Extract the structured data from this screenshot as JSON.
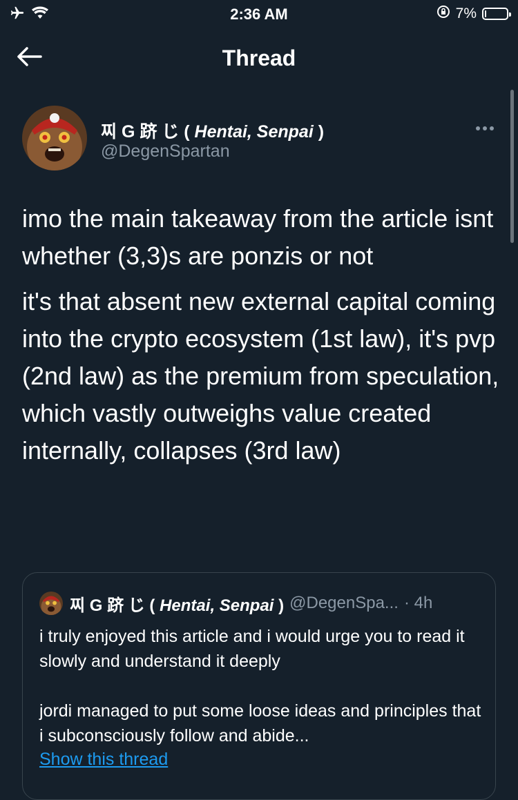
{
  "status_bar": {
    "time": "2:36 AM",
    "battery": "7%",
    "battery_level": 0.07,
    "icons": [
      "airplane-icon",
      "wifi-icon",
      "orientation-lock-icon",
      "battery-icon"
    ]
  },
  "nav": {
    "title": "Thread",
    "back_icon": "back-arrow-icon"
  },
  "tweet": {
    "author": {
      "name_cjk": "찌 G 跻 じ ( ",
      "name_latin": "Hentai, Senpai",
      "name_close": " )",
      "handle": "@DegenSpartan"
    },
    "more_icon": "more-options-icon",
    "paragraphs": [
      "imo the main takeaway from the article isnt whether (3,3)s are ponzis or not",
      "it's that absent new external capital coming into the crypto ecosystem (1st law), it's pvp (2nd law) as the premium from speculation, which vastly outweighs value created internally, collapses (3rd law)"
    ]
  },
  "quote": {
    "author": {
      "name_cjk": "찌 G 跻 じ ( ",
      "name_latin": "Hentai, Senpai",
      "name_close": " )",
      "handle": "@DegenSpa...",
      "time": "· 4h"
    },
    "paragraphs": [
      "i truly enjoyed this article and i would urge you to read it slowly and understand it deeply",
      "jordi managed to put some loose ideas and principles that i subconsciously follow and abide..."
    ],
    "show_thread": "Show this thread"
  },
  "colors": {
    "background": "#15202b",
    "text": "#ffffff",
    "secondary_text": "#8b98a5",
    "link": "#1d9bf0",
    "border": "#38444d"
  }
}
